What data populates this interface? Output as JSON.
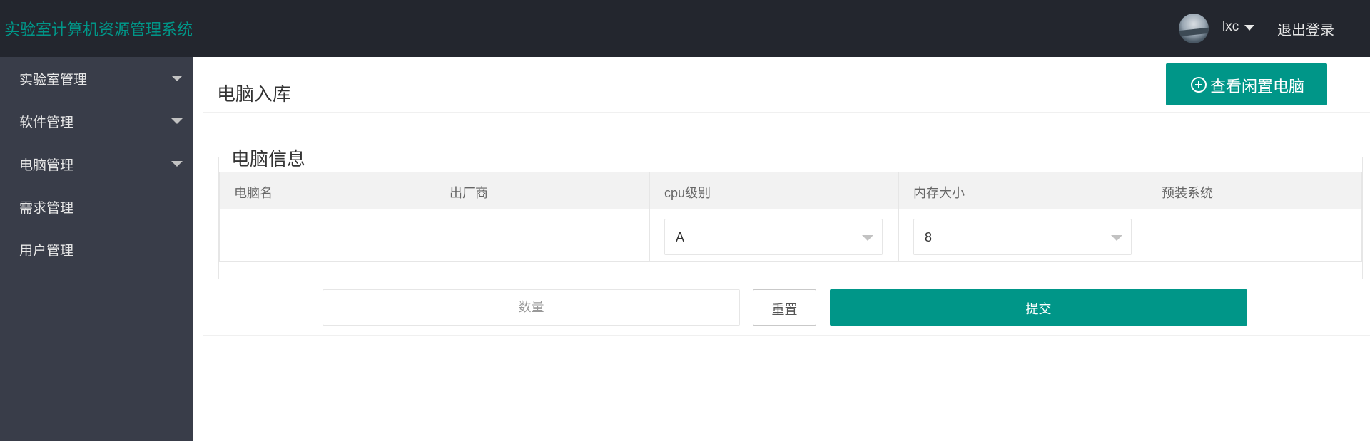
{
  "header": {
    "app_title": "实验室计算机资源管理系统",
    "username": "lxc",
    "logout_label": "退出登录"
  },
  "sidebar": {
    "items": [
      {
        "label": "实验室管理",
        "expandable": true
      },
      {
        "label": "软件管理",
        "expandable": true
      },
      {
        "label": "电脑管理",
        "expandable": true
      },
      {
        "label": "需求管理",
        "expandable": false
      },
      {
        "label": "用户管理",
        "expandable": false
      }
    ]
  },
  "main": {
    "page_title": "电脑入库",
    "idle_button_label": "查看闲置电脑",
    "fieldset_legend": "电脑信息",
    "table": {
      "columns": [
        "电脑名",
        "出厂商",
        "cpu级别",
        "内存大小",
        "预装系统"
      ],
      "row": {
        "computer_name": "",
        "manufacturer": "",
        "cpu_level": "A",
        "memory_size": "8",
        "preinstalled_os": ""
      }
    },
    "quantity_placeholder": "数量",
    "reset_label": "重置",
    "submit_label": "提交"
  },
  "colors": {
    "header_bg": "#23262e",
    "sidebar_bg": "#393d49",
    "accent": "#009688"
  },
  "icons": [
    "avatar",
    "chevron-down-icon",
    "plus-circle-icon"
  ]
}
